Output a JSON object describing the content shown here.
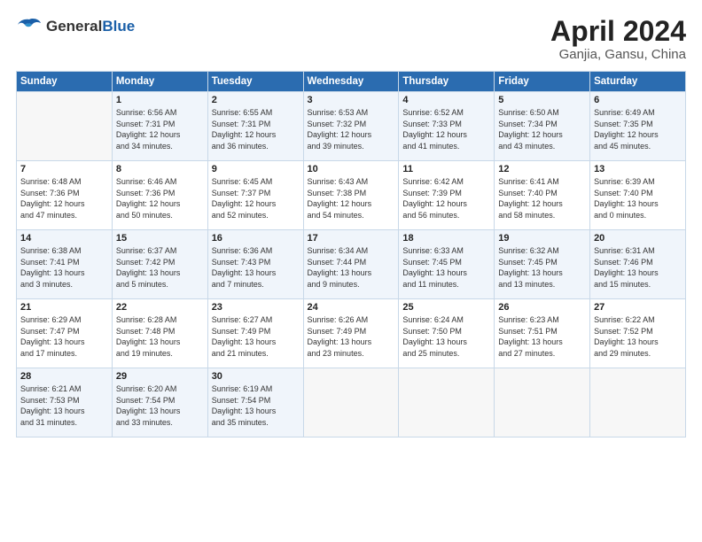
{
  "header": {
    "logo_general": "General",
    "logo_blue": "Blue",
    "title": "April 2024",
    "subtitle": "Ganjia, Gansu, China"
  },
  "columns": [
    "Sunday",
    "Monday",
    "Tuesday",
    "Wednesday",
    "Thursday",
    "Friday",
    "Saturday"
  ],
  "rows": [
    [
      {
        "day": "",
        "lines": []
      },
      {
        "day": "1",
        "lines": [
          "Sunrise: 6:56 AM",
          "Sunset: 7:31 PM",
          "Daylight: 12 hours",
          "and 34 minutes."
        ]
      },
      {
        "day": "2",
        "lines": [
          "Sunrise: 6:55 AM",
          "Sunset: 7:31 PM",
          "Daylight: 12 hours",
          "and 36 minutes."
        ]
      },
      {
        "day": "3",
        "lines": [
          "Sunrise: 6:53 AM",
          "Sunset: 7:32 PM",
          "Daylight: 12 hours",
          "and 39 minutes."
        ]
      },
      {
        "day": "4",
        "lines": [
          "Sunrise: 6:52 AM",
          "Sunset: 7:33 PM",
          "Daylight: 12 hours",
          "and 41 minutes."
        ]
      },
      {
        "day": "5",
        "lines": [
          "Sunrise: 6:50 AM",
          "Sunset: 7:34 PM",
          "Daylight: 12 hours",
          "and 43 minutes."
        ]
      },
      {
        "day": "6",
        "lines": [
          "Sunrise: 6:49 AM",
          "Sunset: 7:35 PM",
          "Daylight: 12 hours",
          "and 45 minutes."
        ]
      }
    ],
    [
      {
        "day": "7",
        "lines": [
          "Sunrise: 6:48 AM",
          "Sunset: 7:36 PM",
          "Daylight: 12 hours",
          "and 47 minutes."
        ]
      },
      {
        "day": "8",
        "lines": [
          "Sunrise: 6:46 AM",
          "Sunset: 7:36 PM",
          "Daylight: 12 hours",
          "and 50 minutes."
        ]
      },
      {
        "day": "9",
        "lines": [
          "Sunrise: 6:45 AM",
          "Sunset: 7:37 PM",
          "Daylight: 12 hours",
          "and 52 minutes."
        ]
      },
      {
        "day": "10",
        "lines": [
          "Sunrise: 6:43 AM",
          "Sunset: 7:38 PM",
          "Daylight: 12 hours",
          "and 54 minutes."
        ]
      },
      {
        "day": "11",
        "lines": [
          "Sunrise: 6:42 AM",
          "Sunset: 7:39 PM",
          "Daylight: 12 hours",
          "and 56 minutes."
        ]
      },
      {
        "day": "12",
        "lines": [
          "Sunrise: 6:41 AM",
          "Sunset: 7:40 PM",
          "Daylight: 12 hours",
          "and 58 minutes."
        ]
      },
      {
        "day": "13",
        "lines": [
          "Sunrise: 6:39 AM",
          "Sunset: 7:40 PM",
          "Daylight: 13 hours",
          "and 0 minutes."
        ]
      }
    ],
    [
      {
        "day": "14",
        "lines": [
          "Sunrise: 6:38 AM",
          "Sunset: 7:41 PM",
          "Daylight: 13 hours",
          "and 3 minutes."
        ]
      },
      {
        "day": "15",
        "lines": [
          "Sunrise: 6:37 AM",
          "Sunset: 7:42 PM",
          "Daylight: 13 hours",
          "and 5 minutes."
        ]
      },
      {
        "day": "16",
        "lines": [
          "Sunrise: 6:36 AM",
          "Sunset: 7:43 PM",
          "Daylight: 13 hours",
          "and 7 minutes."
        ]
      },
      {
        "day": "17",
        "lines": [
          "Sunrise: 6:34 AM",
          "Sunset: 7:44 PM",
          "Daylight: 13 hours",
          "and 9 minutes."
        ]
      },
      {
        "day": "18",
        "lines": [
          "Sunrise: 6:33 AM",
          "Sunset: 7:45 PM",
          "Daylight: 13 hours",
          "and 11 minutes."
        ]
      },
      {
        "day": "19",
        "lines": [
          "Sunrise: 6:32 AM",
          "Sunset: 7:45 PM",
          "Daylight: 13 hours",
          "and 13 minutes."
        ]
      },
      {
        "day": "20",
        "lines": [
          "Sunrise: 6:31 AM",
          "Sunset: 7:46 PM",
          "Daylight: 13 hours",
          "and 15 minutes."
        ]
      }
    ],
    [
      {
        "day": "21",
        "lines": [
          "Sunrise: 6:29 AM",
          "Sunset: 7:47 PM",
          "Daylight: 13 hours",
          "and 17 minutes."
        ]
      },
      {
        "day": "22",
        "lines": [
          "Sunrise: 6:28 AM",
          "Sunset: 7:48 PM",
          "Daylight: 13 hours",
          "and 19 minutes."
        ]
      },
      {
        "day": "23",
        "lines": [
          "Sunrise: 6:27 AM",
          "Sunset: 7:49 PM",
          "Daylight: 13 hours",
          "and 21 minutes."
        ]
      },
      {
        "day": "24",
        "lines": [
          "Sunrise: 6:26 AM",
          "Sunset: 7:49 PM",
          "Daylight: 13 hours",
          "and 23 minutes."
        ]
      },
      {
        "day": "25",
        "lines": [
          "Sunrise: 6:24 AM",
          "Sunset: 7:50 PM",
          "Daylight: 13 hours",
          "and 25 minutes."
        ]
      },
      {
        "day": "26",
        "lines": [
          "Sunrise: 6:23 AM",
          "Sunset: 7:51 PM",
          "Daylight: 13 hours",
          "and 27 minutes."
        ]
      },
      {
        "day": "27",
        "lines": [
          "Sunrise: 6:22 AM",
          "Sunset: 7:52 PM",
          "Daylight: 13 hours",
          "and 29 minutes."
        ]
      }
    ],
    [
      {
        "day": "28",
        "lines": [
          "Sunrise: 6:21 AM",
          "Sunset: 7:53 PM",
          "Daylight: 13 hours",
          "and 31 minutes."
        ]
      },
      {
        "day": "29",
        "lines": [
          "Sunrise: 6:20 AM",
          "Sunset: 7:54 PM",
          "Daylight: 13 hours",
          "and 33 minutes."
        ]
      },
      {
        "day": "30",
        "lines": [
          "Sunrise: 6:19 AM",
          "Sunset: 7:54 PM",
          "Daylight: 13 hours",
          "and 35 minutes."
        ]
      },
      {
        "day": "",
        "lines": []
      },
      {
        "day": "",
        "lines": []
      },
      {
        "day": "",
        "lines": []
      },
      {
        "day": "",
        "lines": []
      }
    ]
  ]
}
